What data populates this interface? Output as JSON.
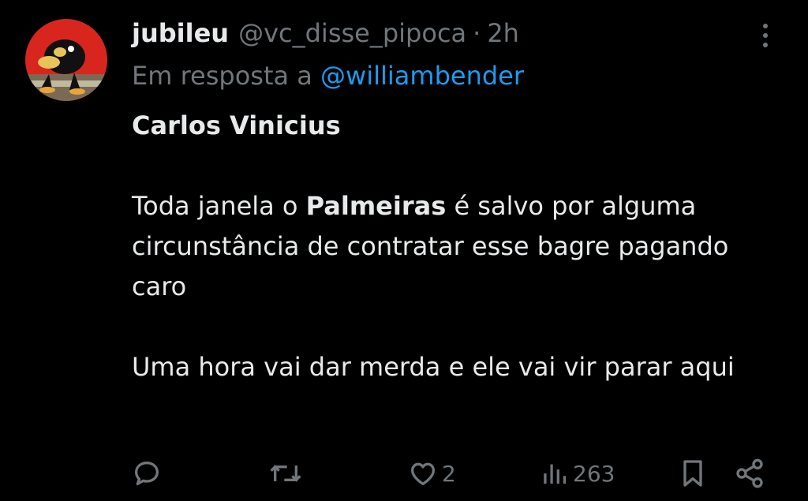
{
  "tweet": {
    "display_name": "jubileu",
    "handle": "@vc_disse_pipoca",
    "separator": "·",
    "time": "2h",
    "reply_prefix": "Em resposta a",
    "reply_to": "@williambender",
    "text": {
      "line1": "Carlos Vinicius",
      "para2_before": "Toda janela o ",
      "para2_bold": "Palmeiras",
      "para2_after": " é salvo por alguma circunstância de contratar esse bagre pagando caro",
      "para3": "Uma hora vai dar merda e ele vai vir parar aqui"
    }
  },
  "actions": {
    "reply_icon": "reply-icon",
    "retweet_icon": "retweet-icon",
    "like_icon": "heart-icon",
    "like_count": "2",
    "views_icon": "views-icon",
    "views_count": "263",
    "bookmark_icon": "bookmark-icon",
    "share_icon": "share-icon"
  },
  "colors": {
    "background": "#000000",
    "text_primary": "#e7e9ea",
    "text_secondary": "#71767b",
    "link": "#1d9bf0"
  }
}
